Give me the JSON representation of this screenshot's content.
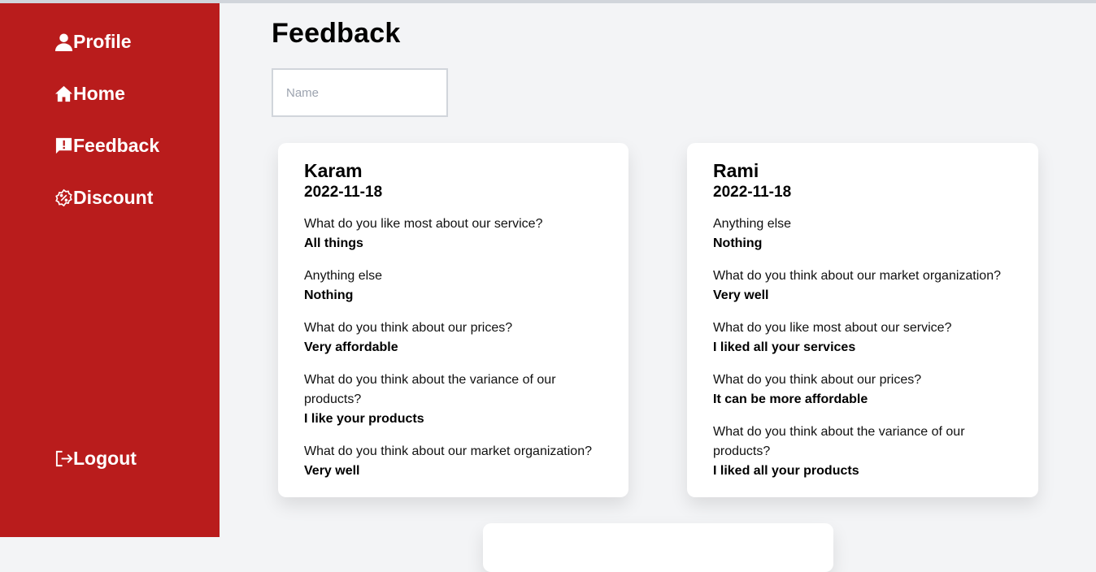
{
  "sidebar": {
    "items": [
      {
        "label": "Profile",
        "icon": "user-icon"
      },
      {
        "label": "Home",
        "icon": "home-icon"
      },
      {
        "label": "Feedback",
        "icon": "feedback-icon"
      },
      {
        "label": "Discount",
        "icon": "discount-icon"
      }
    ],
    "logout": {
      "label": "Logout",
      "icon": "logout-icon"
    }
  },
  "main": {
    "title": "Feedback",
    "search": {
      "placeholder": "Name",
      "value": ""
    },
    "cards": [
      {
        "name": "Karam",
        "date": "2022-11-18",
        "qa": [
          {
            "q": "What do you like most about our service?",
            "a": "All things"
          },
          {
            "q": "Anything else",
            "a": "Nothing"
          },
          {
            "q": "What do you think about our prices?",
            "a": "Very affordable"
          },
          {
            "q": "What do you think about the variance of our products?",
            "a": "I like your products"
          },
          {
            "q": "What do you think about our market organization?",
            "a": "Very well"
          }
        ]
      },
      {
        "name": "Rami",
        "date": "2022-11-18",
        "qa": [
          {
            "q": "Anything else",
            "a": "Nothing"
          },
          {
            "q": "What do you think about our market organization?",
            "a": "Very well"
          },
          {
            "q": "What do you like most about our service?",
            "a": "I liked all your services"
          },
          {
            "q": "What do you think about our prices?",
            "a": "It can be more affordable"
          },
          {
            "q": "What do you think about the variance of our products?",
            "a": "I liked all your products"
          }
        ]
      }
    ]
  },
  "colors": {
    "sidebar": "#b91c1c",
    "background": "#f3f4f6",
    "card": "#ffffff"
  }
}
